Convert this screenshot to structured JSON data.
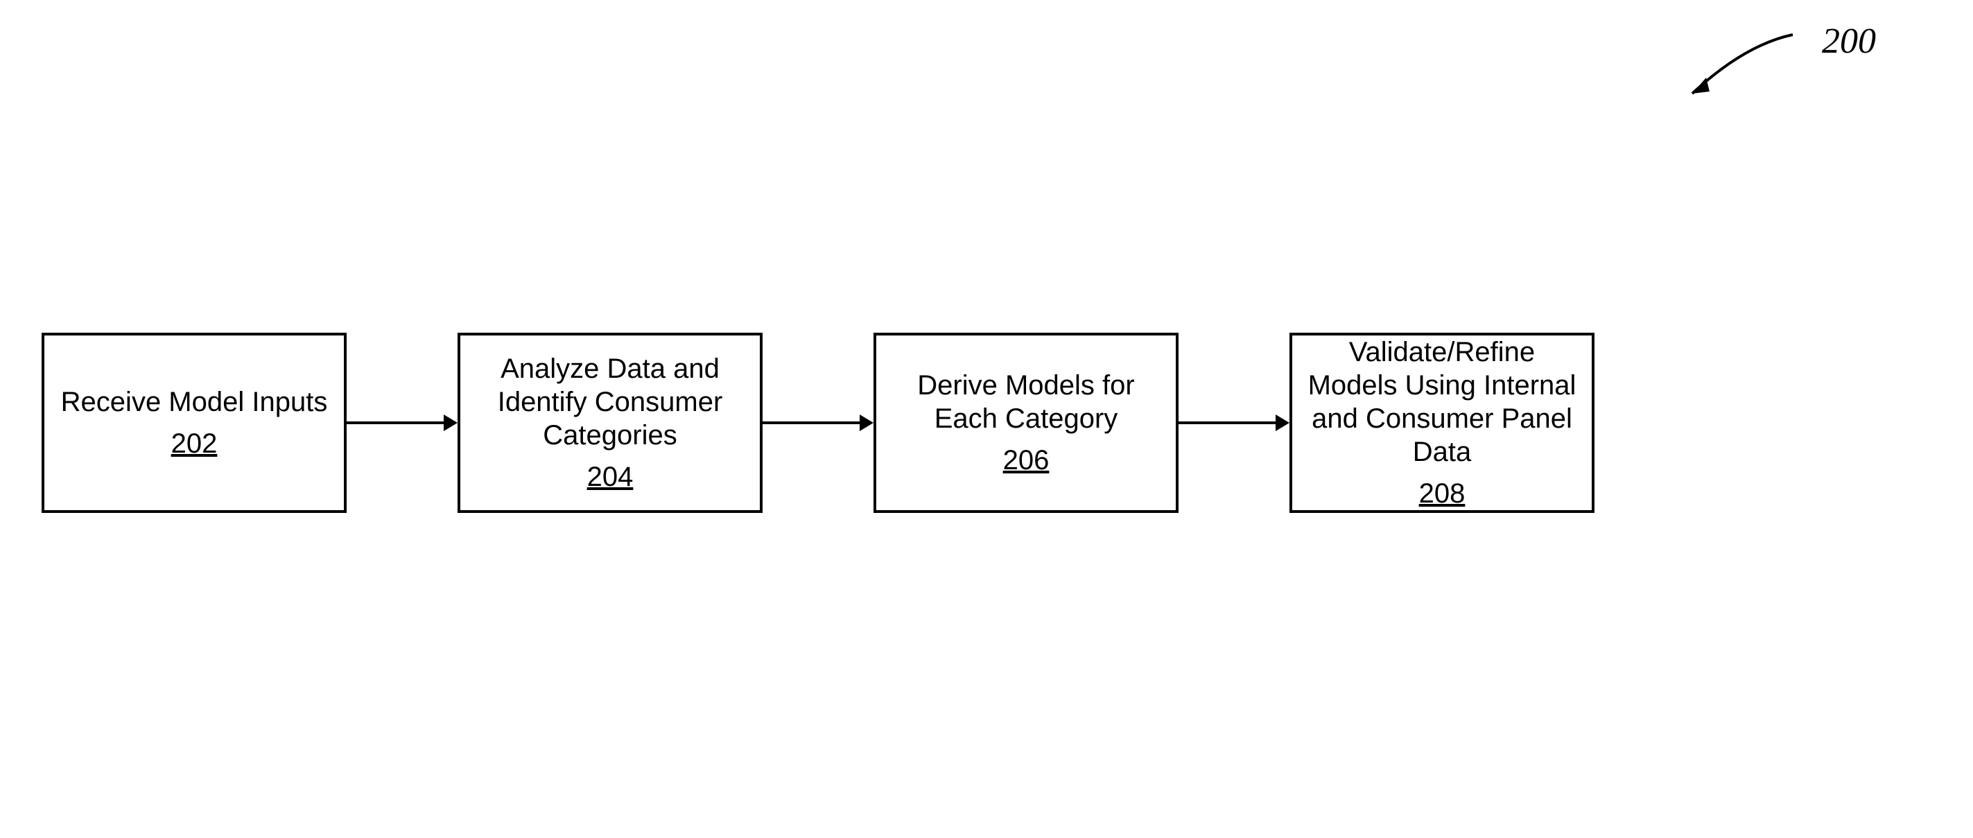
{
  "figure_number": "200",
  "steps": [
    {
      "label": "Receive Model Inputs",
      "num": "202"
    },
    {
      "label": "Analyze Data and Identify Consumer Categories",
      "num": "204"
    },
    {
      "label": "Derive Models for Each Category",
      "num": "206"
    },
    {
      "label": "Validate/Refine Models Using Internal and Consumer Panel Data",
      "num": "208"
    }
  ]
}
